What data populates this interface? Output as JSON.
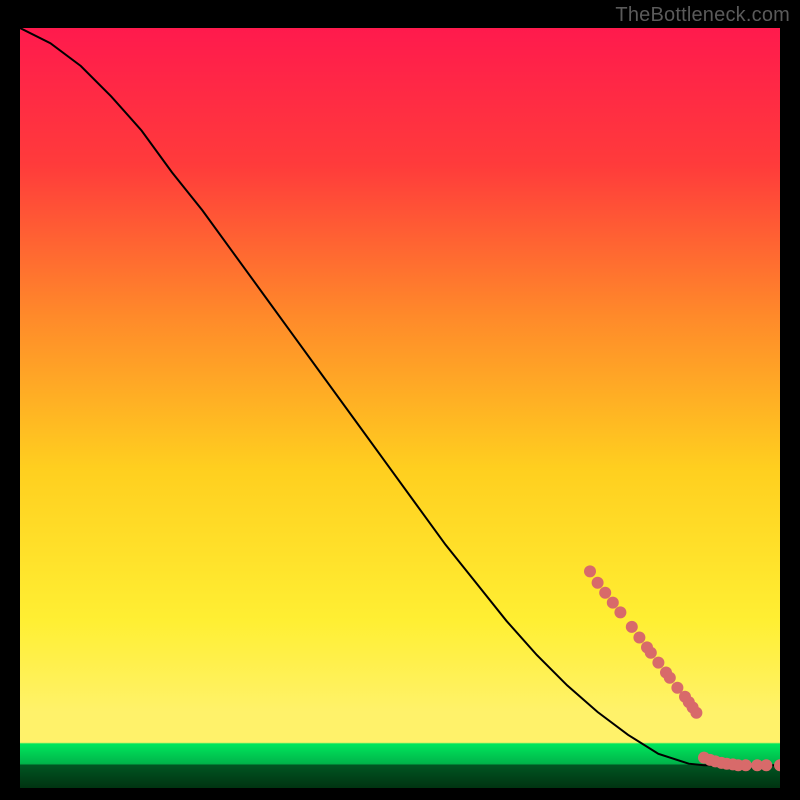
{
  "watermark": "TheBottleneck.com",
  "chart_data": {
    "type": "line",
    "title": "",
    "xlabel": "",
    "ylabel": "",
    "xlim": [
      0,
      100
    ],
    "ylim": [
      0,
      100
    ],
    "grid": false,
    "legend": false,
    "background_gradient": {
      "top_color": "#ff1a4d",
      "mid_color": "#ffe000",
      "green_band": "#00e65c",
      "bottom_color": "#003311"
    },
    "series": [
      {
        "name": "curve",
        "color": "#000000",
        "x": [
          0,
          4,
          8,
          12,
          16,
          20,
          24,
          28,
          32,
          36,
          40,
          44,
          48,
          52,
          56,
          60,
          64,
          68,
          72,
          76,
          80,
          84,
          88,
          90,
          92,
          94,
          96,
          98,
          100
        ],
        "y": [
          100,
          98,
          95,
          91,
          86.5,
          81,
          76,
          70.5,
          65,
          59.5,
          54,
          48.5,
          43,
          37.5,
          32,
          27,
          22,
          17.5,
          13.5,
          10,
          7,
          4.5,
          3.2,
          3.0,
          3.0,
          3.0,
          3.0,
          3.0,
          3.0
        ]
      }
    ],
    "markers": {
      "name": "highlight-points",
      "color": "#d86a6a",
      "radius_px": 6,
      "points": [
        {
          "x": 75.0,
          "y": 28.5
        },
        {
          "x": 76.0,
          "y": 27.0
        },
        {
          "x": 77.0,
          "y": 25.7
        },
        {
          "x": 78.0,
          "y": 24.4
        },
        {
          "x": 79.0,
          "y": 23.1
        },
        {
          "x": 80.5,
          "y": 21.2
        },
        {
          "x": 81.5,
          "y": 19.8
        },
        {
          "x": 82.5,
          "y": 18.5
        },
        {
          "x": 83.0,
          "y": 17.8
        },
        {
          "x": 84.0,
          "y": 16.5
        },
        {
          "x": 85.0,
          "y": 15.2
        },
        {
          "x": 85.5,
          "y": 14.5
        },
        {
          "x": 86.5,
          "y": 13.2
        },
        {
          "x": 87.5,
          "y": 12.0
        },
        {
          "x": 88.0,
          "y": 11.3
        },
        {
          "x": 88.5,
          "y": 10.6
        },
        {
          "x": 89.0,
          "y": 9.9
        },
        {
          "x": 90.0,
          "y": 4.0
        },
        {
          "x": 90.8,
          "y": 3.7
        },
        {
          "x": 91.5,
          "y": 3.5
        },
        {
          "x": 92.3,
          "y": 3.3
        },
        {
          "x": 93.0,
          "y": 3.2
        },
        {
          "x": 93.8,
          "y": 3.1
        },
        {
          "x": 94.5,
          "y": 3.0
        },
        {
          "x": 95.5,
          "y": 3.0
        },
        {
          "x": 97.0,
          "y": 3.0
        },
        {
          "x": 98.2,
          "y": 3.0
        },
        {
          "x": 100.0,
          "y": 3.0
        }
      ]
    }
  }
}
